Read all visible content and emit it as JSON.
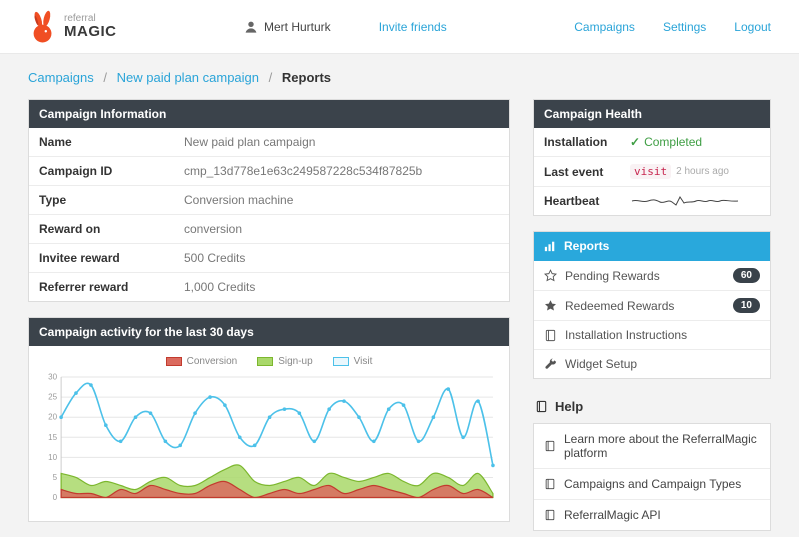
{
  "header": {
    "logo_top": "referral",
    "logo_bottom": "MAGIC",
    "user_name": "Mert Hurturk",
    "invite_label": "Invite friends",
    "nav": [
      {
        "label": "Campaigns"
      },
      {
        "label": "Settings"
      },
      {
        "label": "Logout"
      }
    ]
  },
  "breadcrumb": {
    "separator": "/",
    "items": [
      {
        "label": "Campaigns"
      },
      {
        "label": "New paid plan campaign"
      },
      {
        "label": "Reports"
      }
    ]
  },
  "campaign_info": {
    "title": "Campaign Information",
    "rows": [
      {
        "label": "Name",
        "value": "New paid plan campaign"
      },
      {
        "label": "Campaign ID",
        "value": "cmp_13d778e1e63c249587228c534f87825b"
      },
      {
        "label": "Type",
        "value": "Conversion machine"
      },
      {
        "label": "Reward on",
        "value": "conversion"
      },
      {
        "label": "Invitee reward",
        "value": "500 Credits"
      },
      {
        "label": "Referrer reward",
        "value": "1,000 Credits"
      }
    ]
  },
  "activity": {
    "title": "Campaign activity for the last 30 days"
  },
  "chart_data": {
    "type": "line",
    "title": "Campaign activity for the last 30 days",
    "x": [
      1,
      2,
      3,
      4,
      5,
      6,
      7,
      8,
      9,
      10,
      11,
      12,
      13,
      14,
      15,
      16,
      17,
      18,
      19,
      20,
      21,
      22,
      23,
      24,
      25,
      26,
      27,
      28,
      29,
      30
    ],
    "xlabel": "",
    "ylabel": "",
    "ylim": [
      0,
      30
    ],
    "yticks": [
      0,
      5,
      10,
      15,
      20,
      25,
      30
    ],
    "grid": true,
    "legend_position": "top",
    "series": [
      {
        "name": "Conversion",
        "type": "area",
        "stroke": "#c23b2e",
        "fill": "#db6a5e",
        "values": [
          2,
          1,
          1,
          0,
          2,
          1,
          3,
          2,
          1,
          1,
          3,
          4,
          2,
          0,
          1,
          2,
          1,
          2,
          3,
          1,
          2,
          3,
          2,
          1,
          0,
          2,
          3,
          1,
          2,
          0
        ]
      },
      {
        "name": "Sign-up",
        "type": "area",
        "stroke": "#7cb72e",
        "fill": "#a9d86a",
        "values": [
          6,
          5,
          3,
          4,
          3,
          2,
          4,
          5,
          3,
          3,
          5,
          7,
          8,
          4,
          3,
          4,
          5,
          3,
          6,
          5,
          4,
          5,
          6,
          4,
          3,
          6,
          5,
          3,
          6,
          1
        ]
      },
      {
        "name": "Visit",
        "type": "line",
        "stroke": "#4cc1e9",
        "fill": "none",
        "values": [
          20,
          26,
          28,
          18,
          14,
          20,
          21,
          14,
          13,
          21,
          25,
          23,
          15,
          13,
          20,
          22,
          21,
          14,
          22,
          24,
          20,
          14,
          22,
          23,
          14,
          20,
          27,
          15,
          24,
          8
        ]
      }
    ]
  },
  "health": {
    "title": "Campaign Health",
    "rows": [
      {
        "label": "Installation",
        "value": "Completed"
      },
      {
        "label": "Last event",
        "value": "visit",
        "suffix": "2 hours ago"
      },
      {
        "label": "Heartbeat"
      }
    ]
  },
  "menu": {
    "items": [
      {
        "label": "Reports",
        "icon": "bar-chart-icon",
        "active": true
      },
      {
        "label": "Pending Rewards",
        "icon": "star-outline-icon",
        "badge": "60"
      },
      {
        "label": "Redeemed Rewards",
        "icon": "star-icon",
        "badge": "10"
      },
      {
        "label": "Installation Instructions",
        "icon": "book-icon"
      },
      {
        "label": "Widget Setup",
        "icon": "wrench-icon"
      }
    ]
  },
  "help": {
    "title": "Help",
    "items": [
      {
        "label": "Learn more about the ReferralMagic platform"
      },
      {
        "label": "Campaigns and Campaign Types"
      },
      {
        "label": "ReferralMagic API"
      }
    ]
  },
  "colors": {
    "accent_link": "#2aa4d8",
    "panel_header": "#3b434b",
    "active_menu": "#29a8dc",
    "success": "#3f9e44",
    "badge": "#39424a",
    "event_code": "#c7254e"
  }
}
